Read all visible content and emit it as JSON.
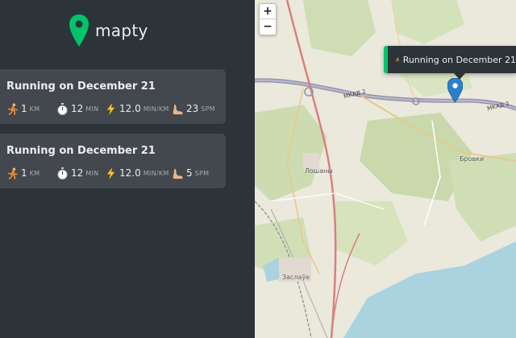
{
  "app": {
    "logo_text": "mapty",
    "accent_color": "#00c46a",
    "running_color": "#00c46a"
  },
  "workouts": [
    {
      "title": "Running on December 21",
      "type": "running",
      "stats": [
        {
          "icon": "runner-icon",
          "value": "1",
          "unit": "KM"
        },
        {
          "icon": "stopwatch-icon",
          "value": "12",
          "unit": "MIN"
        },
        {
          "icon": "lightning-icon",
          "value": "12.0",
          "unit": "MIN/KM"
        },
        {
          "icon": "footprint-icon",
          "value": "23",
          "unit": "SPM"
        }
      ]
    },
    {
      "title": "Running on December 21",
      "type": "running",
      "stats": [
        {
          "icon": "runner-icon",
          "value": "1",
          "unit": "KM"
        },
        {
          "icon": "stopwatch-icon",
          "value": "12",
          "unit": "MIN"
        },
        {
          "icon": "lightning-icon",
          "value": "12.0",
          "unit": "MIN/KM"
        },
        {
          "icon": "footprint-icon",
          "value": "5",
          "unit": "SPM"
        }
      ]
    }
  ],
  "map": {
    "zoom_in": "+",
    "zoom_out": "−",
    "popup_text": "Running on December 21",
    "popup_icon": "runner-icon",
    "marker_icon": "map-marker-icon",
    "labels": {
      "road_mkad_left": "МКАД 2",
      "road_mkad_right": "МКАД 2",
      "town_1": "Лошаны",
      "town_2": "Заслаўе",
      "town_3": "Бровки"
    }
  }
}
